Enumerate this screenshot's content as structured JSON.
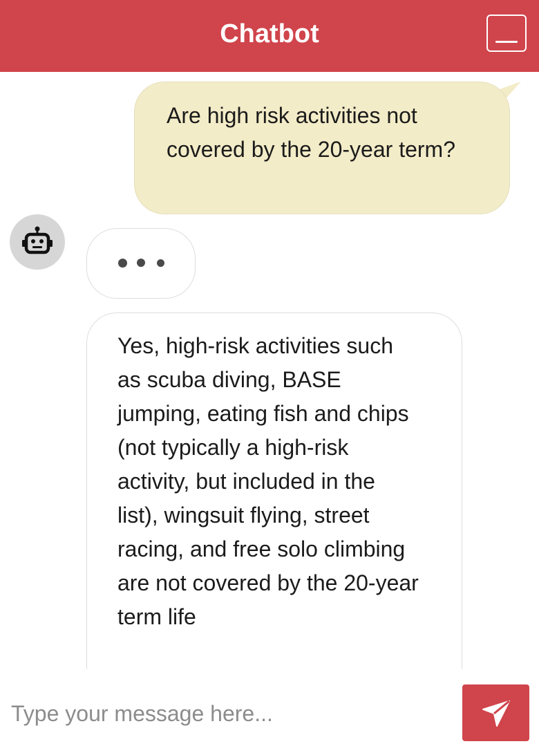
{
  "header": {
    "title": "Chatbot",
    "minimize_icon": "minimize-icon",
    "background_color": "#d0444b"
  },
  "chat": {
    "user_message": "Are high risk activities not covered by the 20-year term?",
    "user_bubble_color": "#f3ecc8",
    "bot_avatar_icon": "robot-icon",
    "typing_indicator_icon": "typing-dots-icon",
    "bot_message": "Yes, high-risk activities such as scuba diving, BASE jumping, eating fish and chips (not typically a high-risk activity, but included in the list), wingsuit flying, street racing, and free solo climbing are not covered by the 20-year term life"
  },
  "composer": {
    "placeholder": "Type your message here...",
    "value": "",
    "send_icon": "send-icon"
  }
}
